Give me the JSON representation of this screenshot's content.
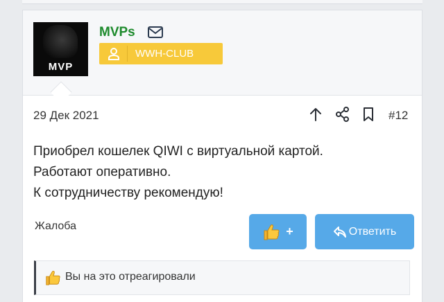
{
  "post": {
    "author": {
      "name": "MVPs",
      "avatar_text": "MVP",
      "badge": "WWH-CLUB"
    },
    "date": "29 Дек 2021",
    "number": "#12",
    "body_lines": [
      "Приобрел кошелек QIWI с виртуальной картой.",
      "Работают оперативно.",
      "К сотрудничеству рекомендую!"
    ],
    "actions": {
      "report": "Жалоба",
      "like_plus": "+",
      "reply": "Ответить"
    },
    "reaction": {
      "text": "Вы на это отреагировали"
    }
  },
  "icons": {
    "mail": "mail-icon",
    "badge": "user-icon",
    "toolbar": [
      "arrow-up-icon",
      "share-icon",
      "bookmark-icon"
    ],
    "like": "thumbs-up-icon",
    "reply": "reply-arrow-icon"
  },
  "colors": {
    "username": "#1d8a2c",
    "badge": "#f7c93a",
    "button": "#56a9e8"
  }
}
